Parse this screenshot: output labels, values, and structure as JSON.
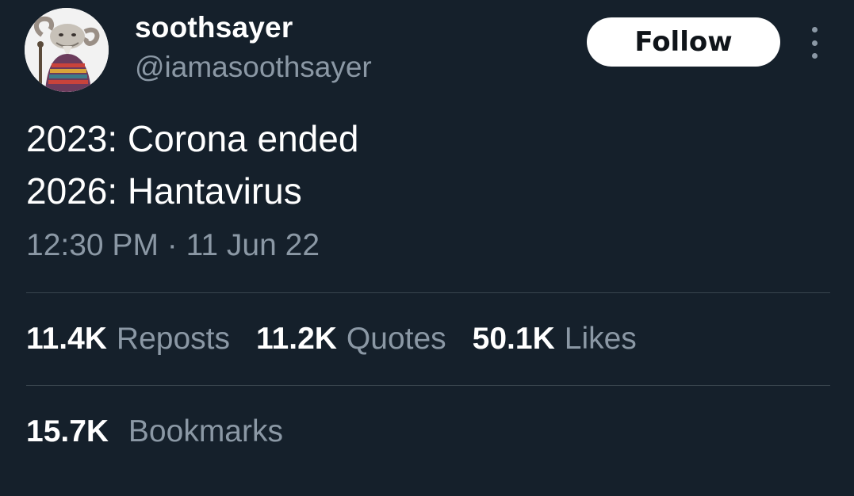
{
  "user": {
    "display_name": "soothsayer",
    "handle": "@iamasoothsayer",
    "avatar_icon": "goat-soothsayer-avatar"
  },
  "actions": {
    "follow_label": "Follow",
    "more_icon": "more-vertical-icon"
  },
  "tweet": {
    "lines": [
      "2023: Corona ended",
      "2026: Hantavirus"
    ],
    "timestamp": "12:30 PM · 11 Jun 22"
  },
  "stats": [
    {
      "count": "11.4K",
      "label": "Reposts"
    },
    {
      "count": "11.2K",
      "label": "Quotes"
    },
    {
      "count": "50.1K",
      "label": "Likes"
    }
  ],
  "bookmarks": {
    "count": "15.7K",
    "label": "Bookmarks"
  },
  "colors": {
    "background": "#15202b",
    "primary_text": "#ffffff",
    "secondary_text": "#8b98a5",
    "divider": "#38444d",
    "follow_button_bg": "#ffffff",
    "follow_button_text": "#0f1419"
  }
}
